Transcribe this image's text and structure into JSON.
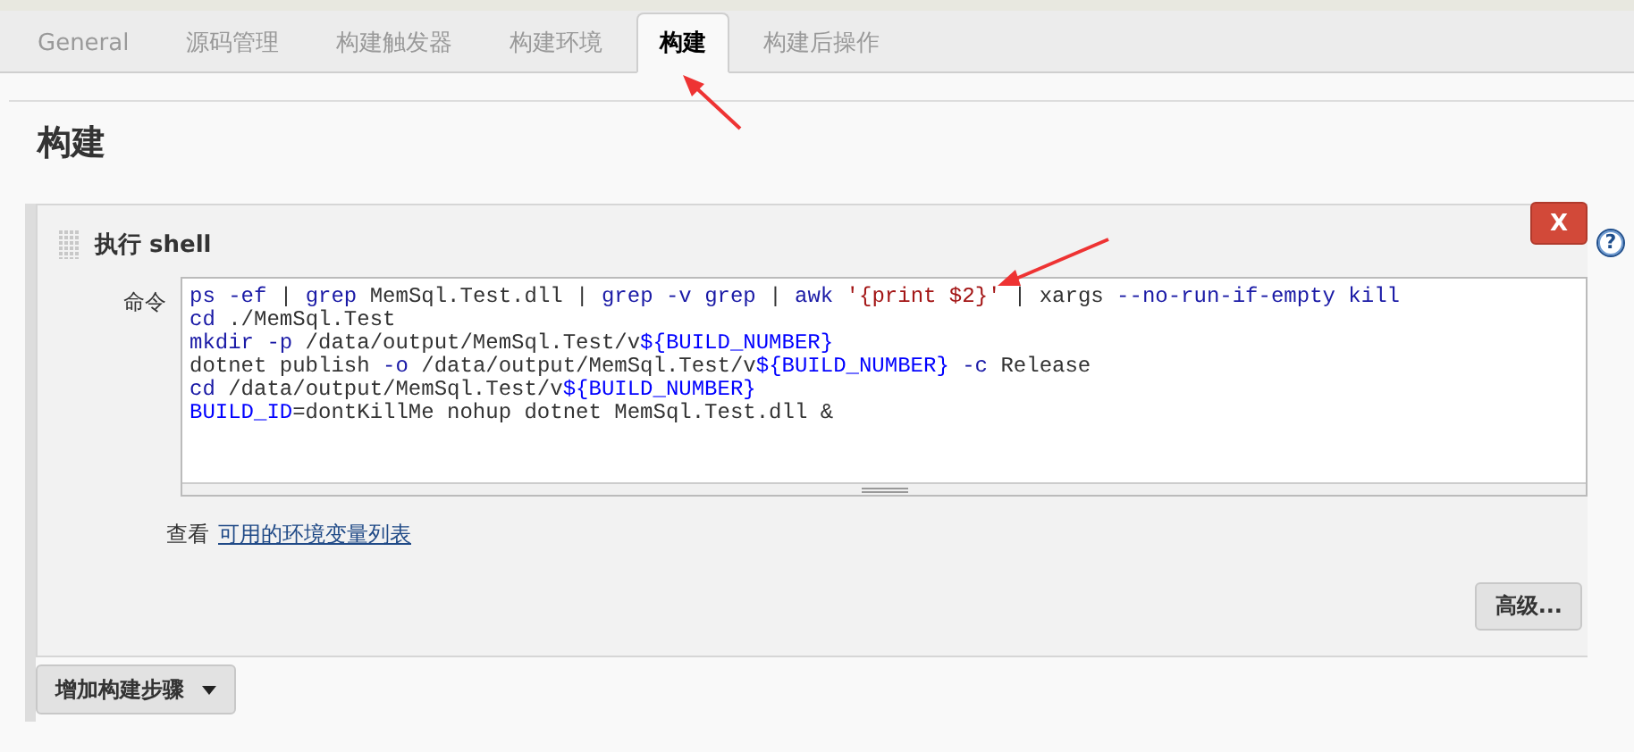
{
  "tabs": [
    {
      "label": "General",
      "selected": false
    },
    {
      "label": "源码管理",
      "selected": false
    },
    {
      "label": "构建触发器",
      "selected": false
    },
    {
      "label": "构建环境",
      "selected": false
    },
    {
      "label": "构建",
      "selected": true
    },
    {
      "label": "构建后操作",
      "selected": false
    }
  ],
  "section_title": "构建",
  "build_step": {
    "title_prefix": "执行",
    "title_suffix": "shell",
    "delete_button": "X",
    "help_icon": "?",
    "command_label": "命令",
    "command_lines": [
      {
        "tokens": [
          {
            "text": "ps -ef",
            "kind": "keyword"
          },
          {
            "text": " | ",
            "kind": "plain"
          },
          {
            "text": "grep",
            "kind": "keyword"
          },
          {
            "text": " MemSql.Test.dll | ",
            "kind": "plain"
          },
          {
            "text": "grep -v grep",
            "kind": "keyword"
          },
          {
            "text": " | ",
            "kind": "plain"
          },
          {
            "text": "awk",
            "kind": "keyword"
          },
          {
            "text": " '{print $2}'",
            "kind": "string"
          },
          {
            "text": " | xargs ",
            "kind": "plain"
          },
          {
            "text": "--no-run-if-empty kill",
            "kind": "keyword"
          }
        ]
      },
      {
        "tokens": [
          {
            "text": "cd",
            "kind": "keyword"
          },
          {
            "text": " ./MemSql.Test",
            "kind": "plain"
          }
        ]
      },
      {
        "tokens": [
          {
            "text": "mkdir -p",
            "kind": "keyword"
          },
          {
            "text": " /data/output/MemSql.Test/v",
            "kind": "plain"
          },
          {
            "text": "${BUILD_NUMBER}",
            "kind": "variable"
          }
        ]
      },
      {
        "tokens": [
          {
            "text": "dotnet publish ",
            "kind": "plain"
          },
          {
            "text": "-o",
            "kind": "keyword"
          },
          {
            "text": " /data/output/MemSql.Test/v",
            "kind": "plain"
          },
          {
            "text": "${BUILD_NUMBER}",
            "kind": "variable"
          },
          {
            "text": " -c",
            "kind": "keyword"
          },
          {
            "text": " Release",
            "kind": "plain"
          }
        ]
      },
      {
        "tokens": [
          {
            "text": "cd",
            "kind": "keyword"
          },
          {
            "text": " /data/output/MemSql.Test/v",
            "kind": "plain"
          },
          {
            "text": "${BUILD_NUMBER}",
            "kind": "variable"
          }
        ]
      },
      {
        "tokens": [
          {
            "text": "BUILD_ID",
            "kind": "variable"
          },
          {
            "text": "=dontKillMe nohup dotnet MemSql.Test.dll &",
            "kind": "plain"
          }
        ]
      }
    ],
    "env_hint_prefix": "查看",
    "env_link": "可用的环境变量列表",
    "advanced_button": "高级..."
  },
  "add_step_button": "增加构建步骤"
}
